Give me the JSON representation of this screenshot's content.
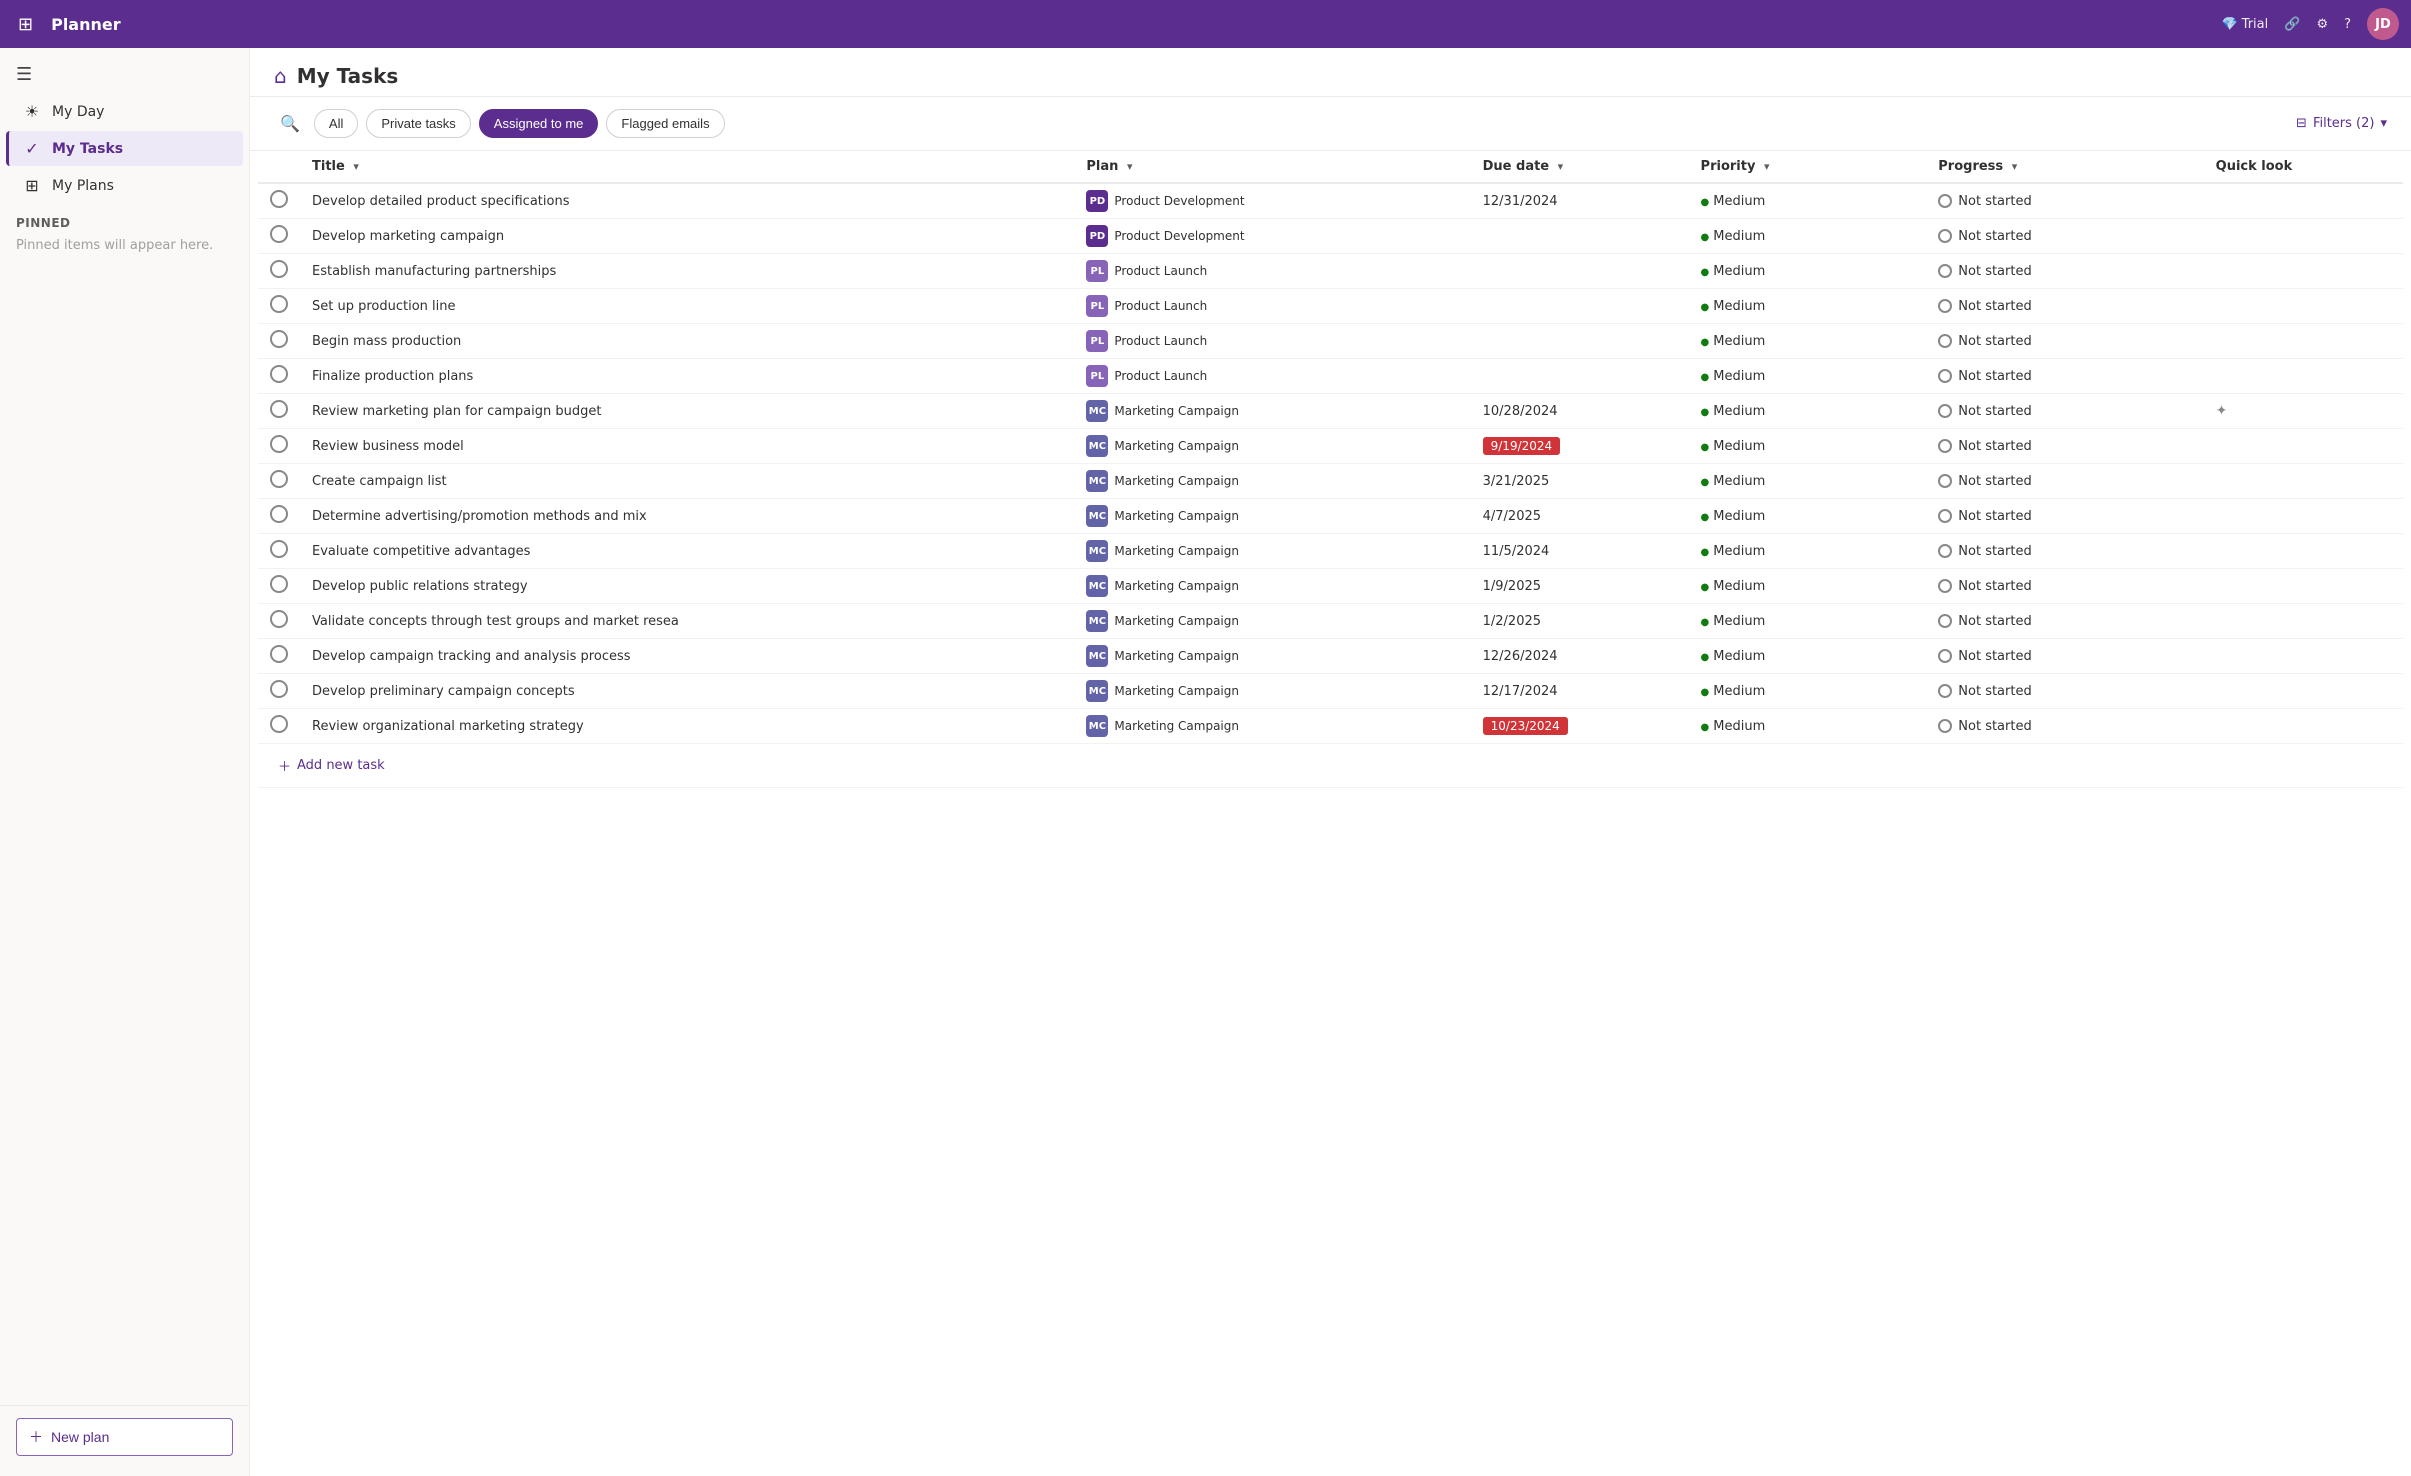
{
  "app": {
    "name": "Planner",
    "waffle_icon": "⊞",
    "trial_label": "Trial",
    "avatar_initials": "JD"
  },
  "sidebar": {
    "toggle_icon": "☰",
    "items": [
      {
        "id": "my-day",
        "label": "My Day",
        "icon": "☀"
      },
      {
        "id": "my-tasks",
        "label": "My Tasks",
        "icon": "✓",
        "active": true
      },
      {
        "id": "my-plans",
        "label": "My Plans",
        "icon": "⊞"
      }
    ],
    "pinned_label": "Pinned",
    "pinned_empty": "Pinned items will appear here.",
    "new_plan_label": "New plan"
  },
  "page": {
    "title": "My Tasks",
    "header_icon": "⌂"
  },
  "filter_bar": {
    "tabs": [
      {
        "id": "all",
        "label": "All",
        "active": false
      },
      {
        "id": "private-tasks",
        "label": "Private tasks",
        "active": false
      },
      {
        "id": "assigned-to-me",
        "label": "Assigned to me",
        "active": true
      },
      {
        "id": "flagged-emails",
        "label": "Flagged emails",
        "active": false
      }
    ],
    "filters_label": "Filters (2)",
    "filter_icon": "⊟"
  },
  "table": {
    "columns": [
      {
        "id": "title",
        "label": "Title",
        "sort": true
      },
      {
        "id": "plan",
        "label": "Plan",
        "sort": true
      },
      {
        "id": "due-date",
        "label": "Due date",
        "sort": true
      },
      {
        "id": "priority",
        "label": "Priority",
        "sort": true
      },
      {
        "id": "progress",
        "label": "Progress",
        "sort": true
      },
      {
        "id": "quick-look",
        "label": "Quick look",
        "sort": false
      }
    ],
    "tasks": [
      {
        "id": 1,
        "title": "Develop detailed product specifications",
        "plan_abbr": "PD",
        "plan_color": "plan-pd",
        "plan_name": "Product Development",
        "due_date": "12/31/2024",
        "due_overdue": false,
        "priority": "Medium",
        "progress": "Not started"
      },
      {
        "id": 2,
        "title": "Develop marketing campaign",
        "plan_abbr": "PD",
        "plan_color": "plan-pd",
        "plan_name": "Product Development",
        "due_date": "",
        "due_overdue": false,
        "priority": "Medium",
        "progress": "Not started"
      },
      {
        "id": 3,
        "title": "Establish manufacturing partnerships",
        "plan_abbr": "PL",
        "plan_color": "plan-pl",
        "plan_name": "Product Launch",
        "due_date": "",
        "due_overdue": false,
        "priority": "Medium",
        "progress": "Not started"
      },
      {
        "id": 4,
        "title": "Set up production line",
        "plan_abbr": "PL",
        "plan_color": "plan-pl",
        "plan_name": "Product Launch",
        "due_date": "",
        "due_overdue": false,
        "priority": "Medium",
        "progress": "Not started"
      },
      {
        "id": 5,
        "title": "Begin mass production",
        "plan_abbr": "PL",
        "plan_color": "plan-pl",
        "plan_name": "Product Launch",
        "due_date": "",
        "due_overdue": false,
        "priority": "Medium",
        "progress": "Not started"
      },
      {
        "id": 6,
        "title": "Finalize production plans",
        "plan_abbr": "PL",
        "plan_color": "plan-pl",
        "plan_name": "Product Launch",
        "due_date": "",
        "due_overdue": false,
        "priority": "Medium",
        "progress": "Not started"
      },
      {
        "id": 7,
        "title": "Review marketing plan for campaign budget",
        "plan_abbr": "MC",
        "plan_color": "plan-mc",
        "plan_name": "Marketing Campaign",
        "due_date": "10/28/2024",
        "due_overdue": false,
        "priority": "Medium",
        "progress": "Not started",
        "has_quicklook": true
      },
      {
        "id": 8,
        "title": "Review business model",
        "plan_abbr": "MC",
        "plan_color": "plan-mc",
        "plan_name": "Marketing Campaign",
        "due_date": "9/19/2024",
        "due_overdue": true,
        "priority": "Medium",
        "progress": "Not started"
      },
      {
        "id": 9,
        "title": "Create campaign list",
        "plan_abbr": "MC",
        "plan_color": "plan-mc",
        "plan_name": "Marketing Campaign",
        "due_date": "3/21/2025",
        "due_overdue": false,
        "priority": "Medium",
        "progress": "Not started"
      },
      {
        "id": 10,
        "title": "Determine advertising/promotion methods and mix",
        "plan_abbr": "MC",
        "plan_color": "plan-mc",
        "plan_name": "Marketing Campaign",
        "due_date": "4/7/2025",
        "due_overdue": false,
        "priority": "Medium",
        "progress": "Not started"
      },
      {
        "id": 11,
        "title": "Evaluate competitive advantages",
        "plan_abbr": "MC",
        "plan_color": "plan-mc",
        "plan_name": "Marketing Campaign",
        "due_date": "11/5/2024",
        "due_overdue": false,
        "priority": "Medium",
        "progress": "Not started"
      },
      {
        "id": 12,
        "title": "Develop public relations strategy",
        "plan_abbr": "MC",
        "plan_color": "plan-mc",
        "plan_name": "Marketing Campaign",
        "due_date": "1/9/2025",
        "due_overdue": false,
        "priority": "Medium",
        "progress": "Not started"
      },
      {
        "id": 13,
        "title": "Validate concepts through test groups and market resea",
        "plan_abbr": "MC",
        "plan_color": "plan-mc",
        "plan_name": "Marketing Campaign",
        "due_date": "1/2/2025",
        "due_overdue": false,
        "priority": "Medium",
        "progress": "Not started"
      },
      {
        "id": 14,
        "title": "Develop campaign tracking and analysis process",
        "plan_abbr": "MC",
        "plan_color": "plan-mc",
        "plan_name": "Marketing Campaign",
        "due_date": "12/26/2024",
        "due_overdue": false,
        "priority": "Medium",
        "progress": "Not started"
      },
      {
        "id": 15,
        "title": "Develop preliminary campaign concepts",
        "plan_abbr": "MC",
        "plan_color": "plan-mc",
        "plan_name": "Marketing Campaign",
        "due_date": "12/17/2024",
        "due_overdue": false,
        "priority": "Medium",
        "progress": "Not started"
      },
      {
        "id": 16,
        "title": "Review organizational marketing strategy",
        "plan_abbr": "MC",
        "plan_color": "plan-mc",
        "plan_name": "Marketing Campaign",
        "due_date": "10/23/2024",
        "due_overdue": true,
        "priority": "Medium",
        "progress": "Not started"
      }
    ],
    "add_task_label": "Add new task"
  }
}
